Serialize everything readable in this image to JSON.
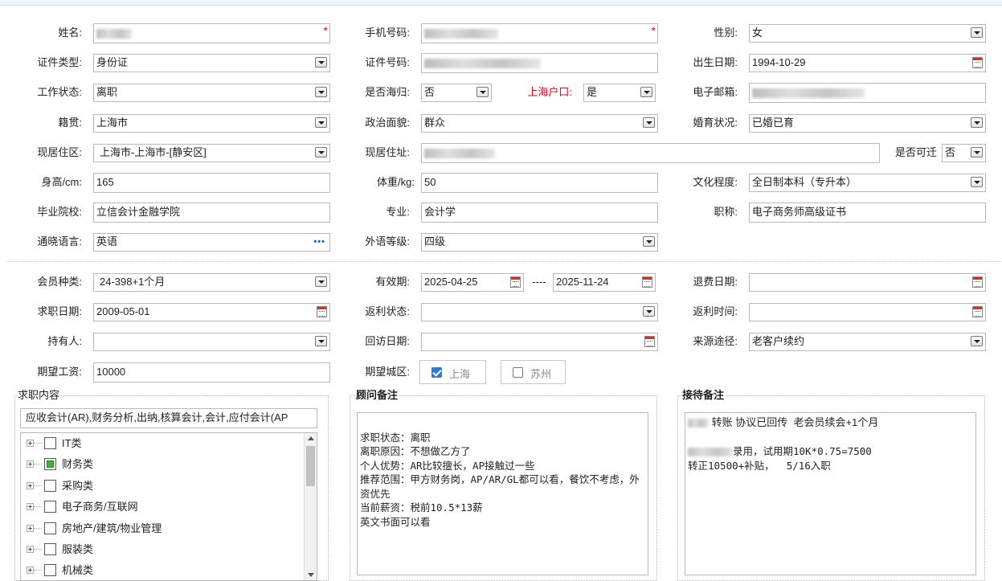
{
  "row1": {
    "name_label": "姓名:",
    "phone_label": "手机号码:",
    "gender_label": "性别:",
    "gender_value": "女"
  },
  "row2": {
    "idtype_label": "证件类型:",
    "idtype_value": "身份证",
    "idno_label": "证件号码:",
    "birth_label": "出生日期:",
    "birth_value": "1994-10-29"
  },
  "row3": {
    "work_label": "工作状态:",
    "work_value": "离职",
    "overseas_label": "是否海归:",
    "overseas_value": "否",
    "hukou_label": "上海户口:",
    "hukou_value": "是",
    "email_label": "电子邮箱:"
  },
  "row4": {
    "native_label": "籍贯:",
    "native_value": "上海市",
    "political_label": "政治面貌:",
    "political_value": "群众",
    "marital_label": "婚育状况:",
    "marital_value": "已婚已育"
  },
  "row5": {
    "area_label": "现居住区:",
    "area_value": "上海市-上海市-[静安区]",
    "address_label": "现居住址:",
    "relocate_label": "是否可迁",
    "relocate_value": "否"
  },
  "row6": {
    "height_label": "身高/cm:",
    "height_value": "165",
    "weight_label": "体重/kg:",
    "weight_value": "50",
    "edu_label": "文化程度:",
    "edu_value": "全日制本科（专升本）"
  },
  "row7": {
    "school_label": "毕业院校:",
    "school_value": "立信会计金融学院",
    "major_label": "专业:",
    "major_value": "会计学",
    "title_label": "职称:",
    "title_value": "电子商务师高级证书"
  },
  "row8": {
    "lang_label": "通晓语言:",
    "lang_value": "英语",
    "langlevel_label": "外语等级:",
    "langlevel_value": "四级"
  },
  "row9": {
    "member_label": "会员种类:",
    "member_value": "24-398+1个月",
    "valid_label": "有效期:",
    "valid_from": "2025-04-25",
    "valid_sep": "----",
    "valid_to": "2025-11-24",
    "refund_label": "退费日期:"
  },
  "row10": {
    "jobdate_label": "求职日期:",
    "jobdate_value": "2009-05-01",
    "rebate_status_label": "返利状态:",
    "rebate_time_label": "返利时间:"
  },
  "row11": {
    "holder_label": "持有人:",
    "visit_label": "回访日期:",
    "source_label": "来源途径:",
    "source_value": "老客户续约"
  },
  "row12": {
    "salary_label": "期望工资:",
    "salary_value": "10000",
    "city_label": "期望城区:",
    "cities": [
      {
        "label": "上海",
        "checked": true
      },
      {
        "label": "苏州",
        "checked": false
      }
    ]
  },
  "job_content": {
    "legend": "求职内容",
    "summary": "应收会计(AR),财务分析,出纳,核算会计,会计,应付会计(AP",
    "tree": [
      {
        "label": "IT类",
        "state": "none"
      },
      {
        "label": "财务类",
        "state": "partial"
      },
      {
        "label": "采购类",
        "state": "none"
      },
      {
        "label": "电子商务/互联网",
        "state": "none"
      },
      {
        "label": "房地产/建筑/物业管理",
        "state": "none"
      },
      {
        "label": "服装类",
        "state": "none"
      },
      {
        "label": "机械类",
        "state": "none"
      }
    ]
  },
  "advisor_notes": {
    "legend": "顾问备注",
    "text": "\n求职状态：离职\n离职原因：不想做乙方了\n个人优势：AR比较擅长，AP接触过一些\n推荐范围：甲方财务岗，AP/AR/GL都可以看，餐饮不考虑，外资优先\n当前薪资：税前10.5*13薪\n英文书面可以看"
  },
  "reception_notes": {
    "legend": "接待备注",
    "line1": " 转账 协议已回传  老会员续会+1个月",
    "line2": "录用，试用期10K*0.75=7500",
    "line3": "转正10500+补贴，  5/16入职"
  }
}
